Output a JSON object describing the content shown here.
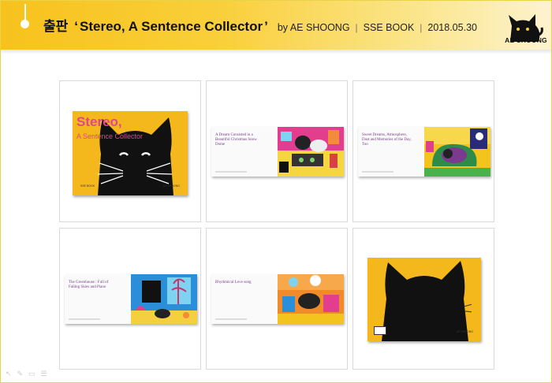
{
  "header": {
    "label": "출판",
    "open_quote": "‘",
    "book_title": "Stereo, A Sentence Collector",
    "close_quote": "’",
    "by": "by AE SHOONG",
    "sep": "|",
    "publisher": "SSE BOOK",
    "date": "2018.05.30",
    "logo_text": "AE SHOONG",
    "logo_icon": "black-cat-logo-icon"
  },
  "thumbnails": [
    {
      "type": "cover",
      "title_line1": "Stereo,",
      "title_line2": "A Sentence Collector",
      "foot_left": "SSE BOOK",
      "foot_right": "AE SHOONG"
    },
    {
      "type": "spread",
      "text": "A Dream Consisted in a Beautiful Christmas Snow Dome",
      "art": "pink-room-scene"
    },
    {
      "type": "spread",
      "text": "Sweet Dreams, Atmosphere, Dust and Memories of the Day, Too",
      "art": "yellow-bedroom-scene"
    },
    {
      "type": "spread",
      "text": "The Greenhouse : Full of Falling Skies and Piano",
      "art": "blue-greenhouse-scene"
    },
    {
      "type": "spread",
      "text": "Rhythmical Love song",
      "art": "orange-band-scene"
    },
    {
      "type": "back-cover",
      "foot_right": "AE SHOONG"
    }
  ],
  "toolbar": {
    "icons": [
      "arrow-icon",
      "pen-icon",
      "comment-icon",
      "menu-icon"
    ]
  },
  "colors": {
    "accent": "#f7c21c",
    "cover": "#f4b71c",
    "title_pink": "#e0478f"
  }
}
